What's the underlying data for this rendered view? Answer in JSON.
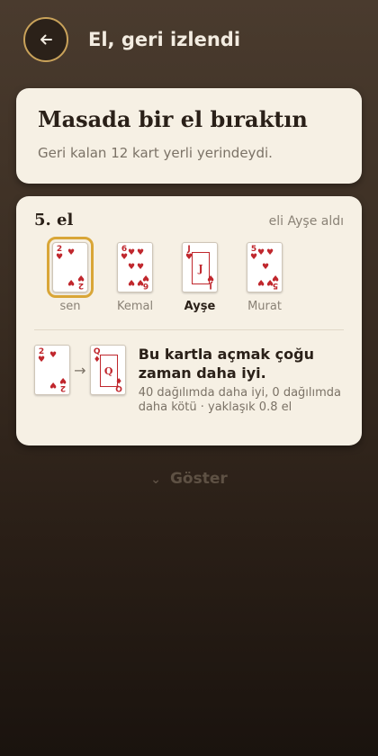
{
  "header": {
    "title": "El, geri izlendi"
  },
  "summary": {
    "title": "Masada bir el bıraktın",
    "subtitle": "Geri kalan 12 kart yerli yerindeydi."
  },
  "hand": {
    "number_label": "5. el",
    "winner_label": "eli Ayşe aldı",
    "players": [
      {
        "name": "sen",
        "card_rank": "2",
        "card_suit": "♥",
        "selected": true,
        "bold": false
      },
      {
        "name": "Kemal",
        "card_rank": "6",
        "card_suit": "♥",
        "selected": false,
        "bold": false
      },
      {
        "name": "Ayşe",
        "card_rank": "J",
        "card_suit": "♥",
        "selected": false,
        "bold": true
      },
      {
        "name": "Murat",
        "card_rank": "5",
        "card_suit": "♥",
        "selected": false,
        "bold": false
      }
    ]
  },
  "advice": {
    "from_card": {
      "rank": "2",
      "suit": "♥"
    },
    "to_card": {
      "rank": "Q",
      "suit": "♦"
    },
    "title": "Bu kartla açmak çoğu zaman daha iyi.",
    "detail": "40 dağılımda daha iyi, 0 dağılımda daha kötü · yaklaşık 0.8 el"
  },
  "show_button": {
    "label": "Göster",
    "icon": "chevron-down-icon"
  },
  "colors": {
    "accent": "#c9a25a",
    "card_red": "#c0272d",
    "panel": "#f6f0e4"
  }
}
